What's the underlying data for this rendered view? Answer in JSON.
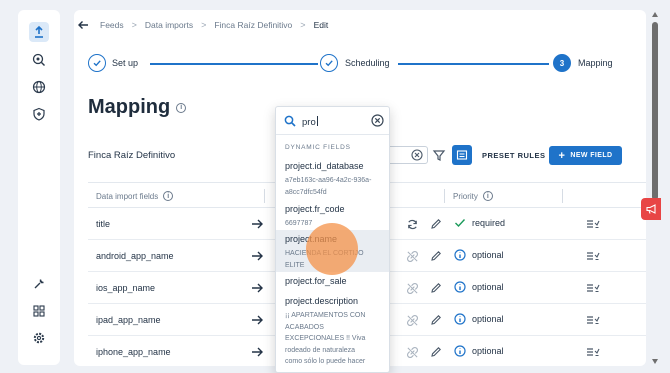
{
  "breadcrumb": [
    "Feeds",
    "Data imports",
    "Finca Raíz Definitivo",
    "Edit"
  ],
  "steps": [
    {
      "label": "Set up",
      "state": "done"
    },
    {
      "label": "Scheduling",
      "state": "done"
    },
    {
      "label": "Mapping",
      "number": "3",
      "state": "current"
    }
  ],
  "page_title": "Mapping",
  "import_name": "Finca Raíz Definitivo",
  "toolbar": {
    "preset_rules": "PRESET RULES",
    "new_field": "NEW FIELD"
  },
  "table": {
    "col_fields": "Data import fields",
    "col_priority": "Priority",
    "rows": [
      {
        "name": "title",
        "priority": "required"
      },
      {
        "name": "android_app_name",
        "priority": "optional"
      },
      {
        "name": "ios_app_name",
        "priority": "optional"
      },
      {
        "name": "ipad_app_name",
        "priority": "optional"
      },
      {
        "name": "iphone_app_name",
        "priority": "optional"
      }
    ]
  },
  "dropdown": {
    "query": "pro",
    "section": "DYNAMIC FIELDS",
    "options": [
      {
        "name": "project.id_database",
        "value": [
          "a7eb163c-aa96-4a2c-936a-",
          "a8cc7dfc54fd"
        ]
      },
      {
        "name": "project.fr_code",
        "value": [
          "6697787"
        ]
      },
      {
        "name": "project.name",
        "value": [
          "HACIENDA EL CORTIJO",
          "ELITE"
        ]
      },
      {
        "name": "project.for_sale",
        "value": []
      },
      {
        "name": "project.description",
        "value": [
          "¡¡ APARTAMENTOS CON",
          "ACABADOS",
          "EXCEPCIONALES !! Viva",
          "rodeado de naturaleza",
          "como sólo lo puede hacer"
        ]
      }
    ]
  },
  "colors": {
    "accent": "#1f73c9",
    "success": "#1a9a5a",
    "alert": "#e84545"
  }
}
